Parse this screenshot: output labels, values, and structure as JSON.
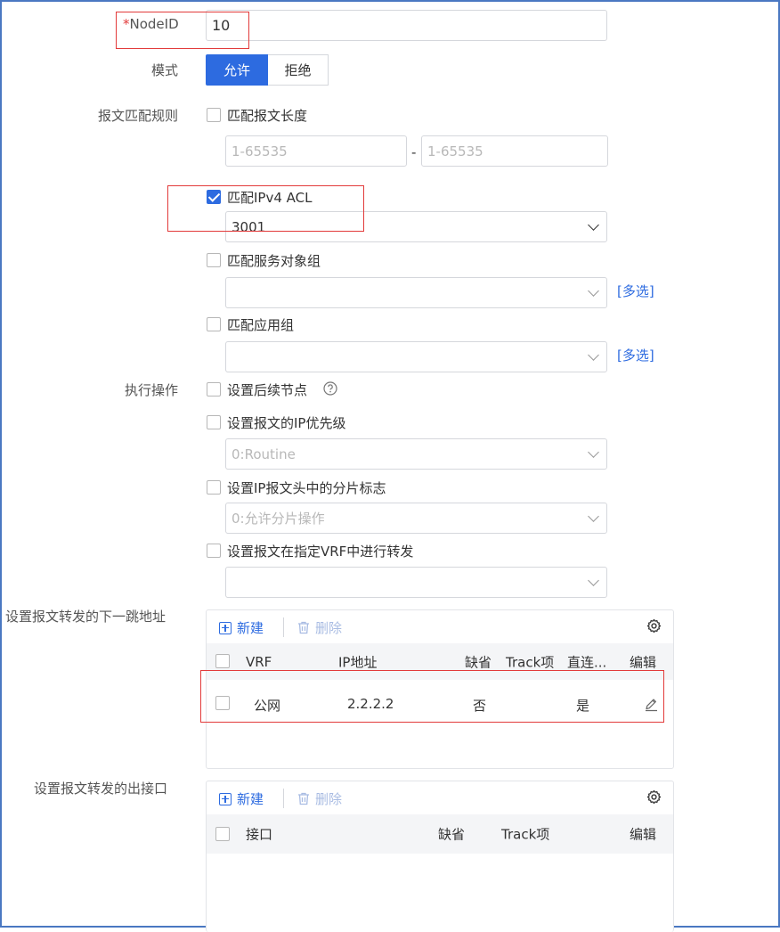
{
  "form": {
    "node_id": {
      "required_mark": "*",
      "label": "NodeID",
      "value": "10"
    },
    "mode": {
      "label": "模式",
      "options": [
        "允许",
        "拒绝"
      ],
      "selected": "允许"
    },
    "match_rules": {
      "label": "报文匹配规则",
      "length": {
        "label": "匹配报文长度",
        "checked": false,
        "from_placeholder": "1-65535",
        "dash": "-",
        "to_placeholder": "1-65535"
      },
      "acl": {
        "label": "匹配IPv4 ACL",
        "checked": true,
        "value": "3001"
      },
      "service_group": {
        "label": "匹配服务对象组",
        "checked": false,
        "value": "",
        "multi_link": "[多选]"
      },
      "app_group": {
        "label": "匹配应用组",
        "checked": false,
        "value": "",
        "multi_link": "[多选]"
      }
    },
    "actions": {
      "label": "执行操作",
      "next_node": {
        "label": "设置后续节点",
        "checked": false,
        "help_icon": "question-circle-icon"
      },
      "ip_priority": {
        "label": "设置报文的IP优先级",
        "checked": false,
        "value": "0:Routine"
      },
      "fragment": {
        "label": "设置IP报文头中的分片标志",
        "checked": false,
        "value": "0:允许分片操作"
      },
      "vrf": {
        "label": "设置报文在指定VRF中进行转发",
        "checked": false,
        "value": ""
      }
    },
    "next_hop": {
      "label": "设置报文转发的下一跳地址",
      "new_label": "新建",
      "delete_label": "删除",
      "columns": [
        "VRF",
        "IP地址",
        "缺省",
        "Track项",
        "直连...",
        "编辑"
      ],
      "rows": [
        {
          "vrf": "公网",
          "ip": "2.2.2.2",
          "default": "否",
          "track": "",
          "direct": "是"
        }
      ]
    },
    "out_interface": {
      "label": "设置报文转发的出接口",
      "new_label": "新建",
      "delete_label": "删除",
      "columns": [
        "接口",
        "缺省",
        "Track项",
        "编辑"
      ],
      "rows": []
    }
  },
  "colors": {
    "accent": "#2d6be0",
    "highlight": "#e23a3a",
    "disabled_text": "#b8b8b8"
  }
}
